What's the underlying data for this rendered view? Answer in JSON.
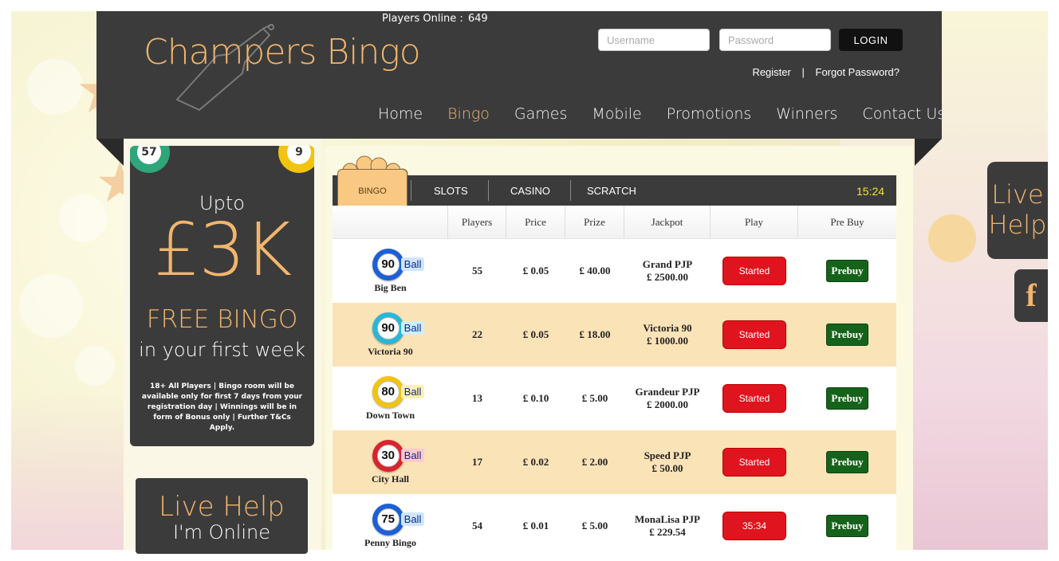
{
  "header": {
    "logo_text": "Champers Bingo",
    "players_online_label": "Players Online :",
    "players_online_count": "649",
    "username_placeholder": "Username",
    "password_placeholder": "Password",
    "login_label": "LOGIN",
    "register_label": "Register",
    "separator": "|",
    "forgot_label": "Forgot Password?",
    "nav": [
      "Home",
      "Bingo",
      "Games",
      "Mobile",
      "Promotions",
      "Winners",
      "Contact Us"
    ],
    "active_nav": "Bingo"
  },
  "promo": {
    "ball_left": "57",
    "ball_right": "9",
    "upto": "Upto",
    "amount": "£3K",
    "free": "FREE BINGO",
    "week": "in your first week",
    "terms": "18+ All Players | Bingo room will be available only for first 7 days from your registration day | Winnings will be in form of Bonus only | Further T&Cs Apply."
  },
  "live_help_box": {
    "title": "Live Help",
    "status": "I'm Online"
  },
  "tabs": {
    "items": [
      "BINGO",
      "SLOTS",
      "CASINO",
      "SCRATCH"
    ],
    "active": "BINGO",
    "clock": "15:24"
  },
  "table": {
    "headers": [
      "",
      "Players",
      "Price",
      "Prize",
      "Jackpot",
      "Play",
      "Pre Buy"
    ],
    "ball_suffix": "Ball",
    "rows": [
      {
        "ball": "90",
        "ball_color": "#1c5fd6",
        "label_bg": "#cfe6ff",
        "name": "Big Ben",
        "players": "55",
        "price": "£ 0.05",
        "prize": "£ 40.00",
        "jackpot_name": "Grand PJP",
        "jackpot_amount": "£ 2500.00",
        "play": "Started",
        "prebuy": "Prebuy"
      },
      {
        "ball": "90",
        "ball_color": "#27b7d9",
        "label_bg": "#cfeeff",
        "name": "Victoria 90",
        "players": "22",
        "price": "£ 0.05",
        "prize": "£ 18.00",
        "jackpot_name": "Victoria 90",
        "jackpot_amount": "£ 1000.00",
        "play": "Started",
        "prebuy": "Prebuy"
      },
      {
        "ball": "80",
        "ball_color": "#f2c40d",
        "label_bg": "#fff2b0",
        "name": "Down Town",
        "players": "13",
        "price": "£ 0.10",
        "prize": "£ 5.00",
        "jackpot_name": "Grandeur PJP",
        "jackpot_amount": "£ 2000.00",
        "play": "Started",
        "prebuy": "Prebuy"
      },
      {
        "ball": "30",
        "ball_color": "#d9232d",
        "label_bg": "#ffc9cd",
        "name": "City Hall",
        "players": "17",
        "price": "£ 0.02",
        "prize": "£ 2.00",
        "jackpot_name": "Speed PJP",
        "jackpot_amount": "£ 50.00",
        "play": "Started",
        "prebuy": "Prebuy"
      },
      {
        "ball": "75",
        "ball_color": "#1c5fd6",
        "label_bg": "#cfe6ff",
        "name": "Penny Bingo",
        "players": "54",
        "price": "£ 0.01",
        "prize": "£ 5.00",
        "jackpot_name": "MonaLisa PJP",
        "jackpot_amount": "£ 229.54",
        "play": "35:34",
        "prebuy": "Prebuy"
      }
    ]
  },
  "side": {
    "live_help_line1": "Live",
    "live_help_line2": "Help",
    "facebook_glyph": "f"
  },
  "colors": {
    "dark": "#3b3b3b",
    "accent": "#f1b66d",
    "started": "#e0141e",
    "prebuy": "#15631a",
    "clock": "#f2e23a"
  }
}
